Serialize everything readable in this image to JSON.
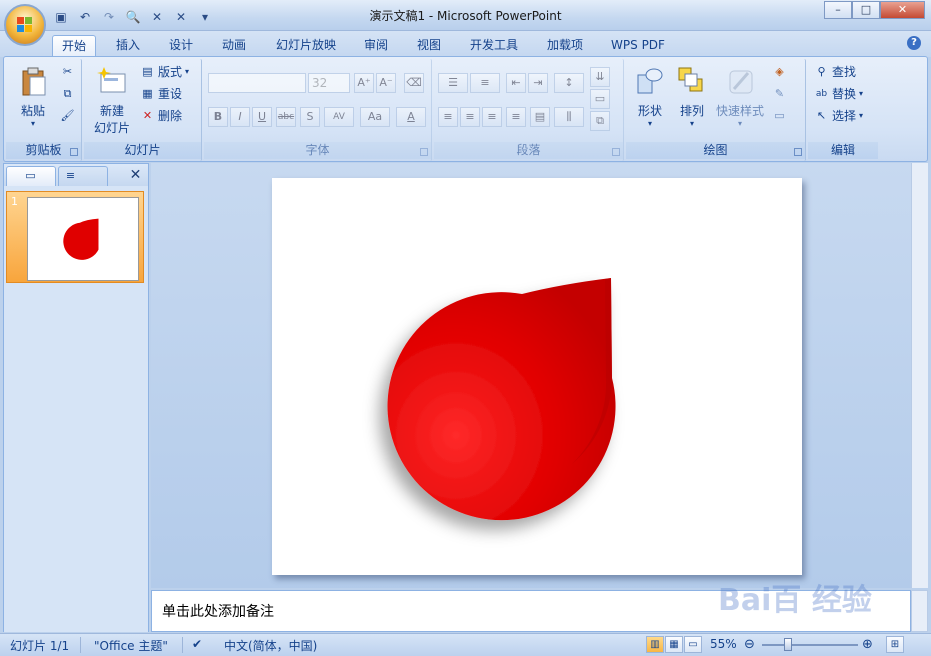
{
  "window": {
    "title": "演示文稿1 - Microsoft PowerPoint"
  },
  "qat": {
    "icons": [
      "save-icon",
      "undo-icon",
      "redo-icon",
      "print-preview-icon",
      "close-icon",
      "close-icon",
      "customize-qat-icon"
    ]
  },
  "tabs": [
    "开始",
    "插入",
    "设计",
    "动画",
    "幻灯片放映",
    "审阅",
    "视图",
    "开发工具",
    "加载项",
    "WPS PDF"
  ],
  "ribbon": {
    "clipboard": {
      "paste": "粘贴",
      "label": "剪贴板"
    },
    "slides": {
      "new_slide_line1": "新建",
      "new_slide_line2": "幻灯片",
      "layout": "版式",
      "reset": "重设",
      "delete": "删除",
      "label": "幻灯片"
    },
    "font": {
      "font_name": "",
      "font_size": "32",
      "label": "字体",
      "buttons": [
        "B",
        "I",
        "U",
        "abc",
        "S",
        "AV",
        "Aa",
        "A"
      ]
    },
    "paragraph": {
      "label": "段落"
    },
    "drawing": {
      "shapes": "形状",
      "arrange": "排列",
      "quick_styles": "快速样式",
      "label": "绘图"
    },
    "editing": {
      "find": "查找",
      "replace": "替换",
      "select": "选择",
      "label": "编辑"
    }
  },
  "thumbs": {
    "slide_number": "1"
  },
  "notes": {
    "placeholder": "单击此处添加备注"
  },
  "status": {
    "slide": "幻灯片 1/1",
    "theme": "\"Office 主题\"",
    "language": "中文(简体，中国)",
    "zoom": "55%"
  },
  "colors": {
    "shape_red": "#e00000",
    "accent": "#15428b"
  },
  "watermark": "Bai百 经验"
}
